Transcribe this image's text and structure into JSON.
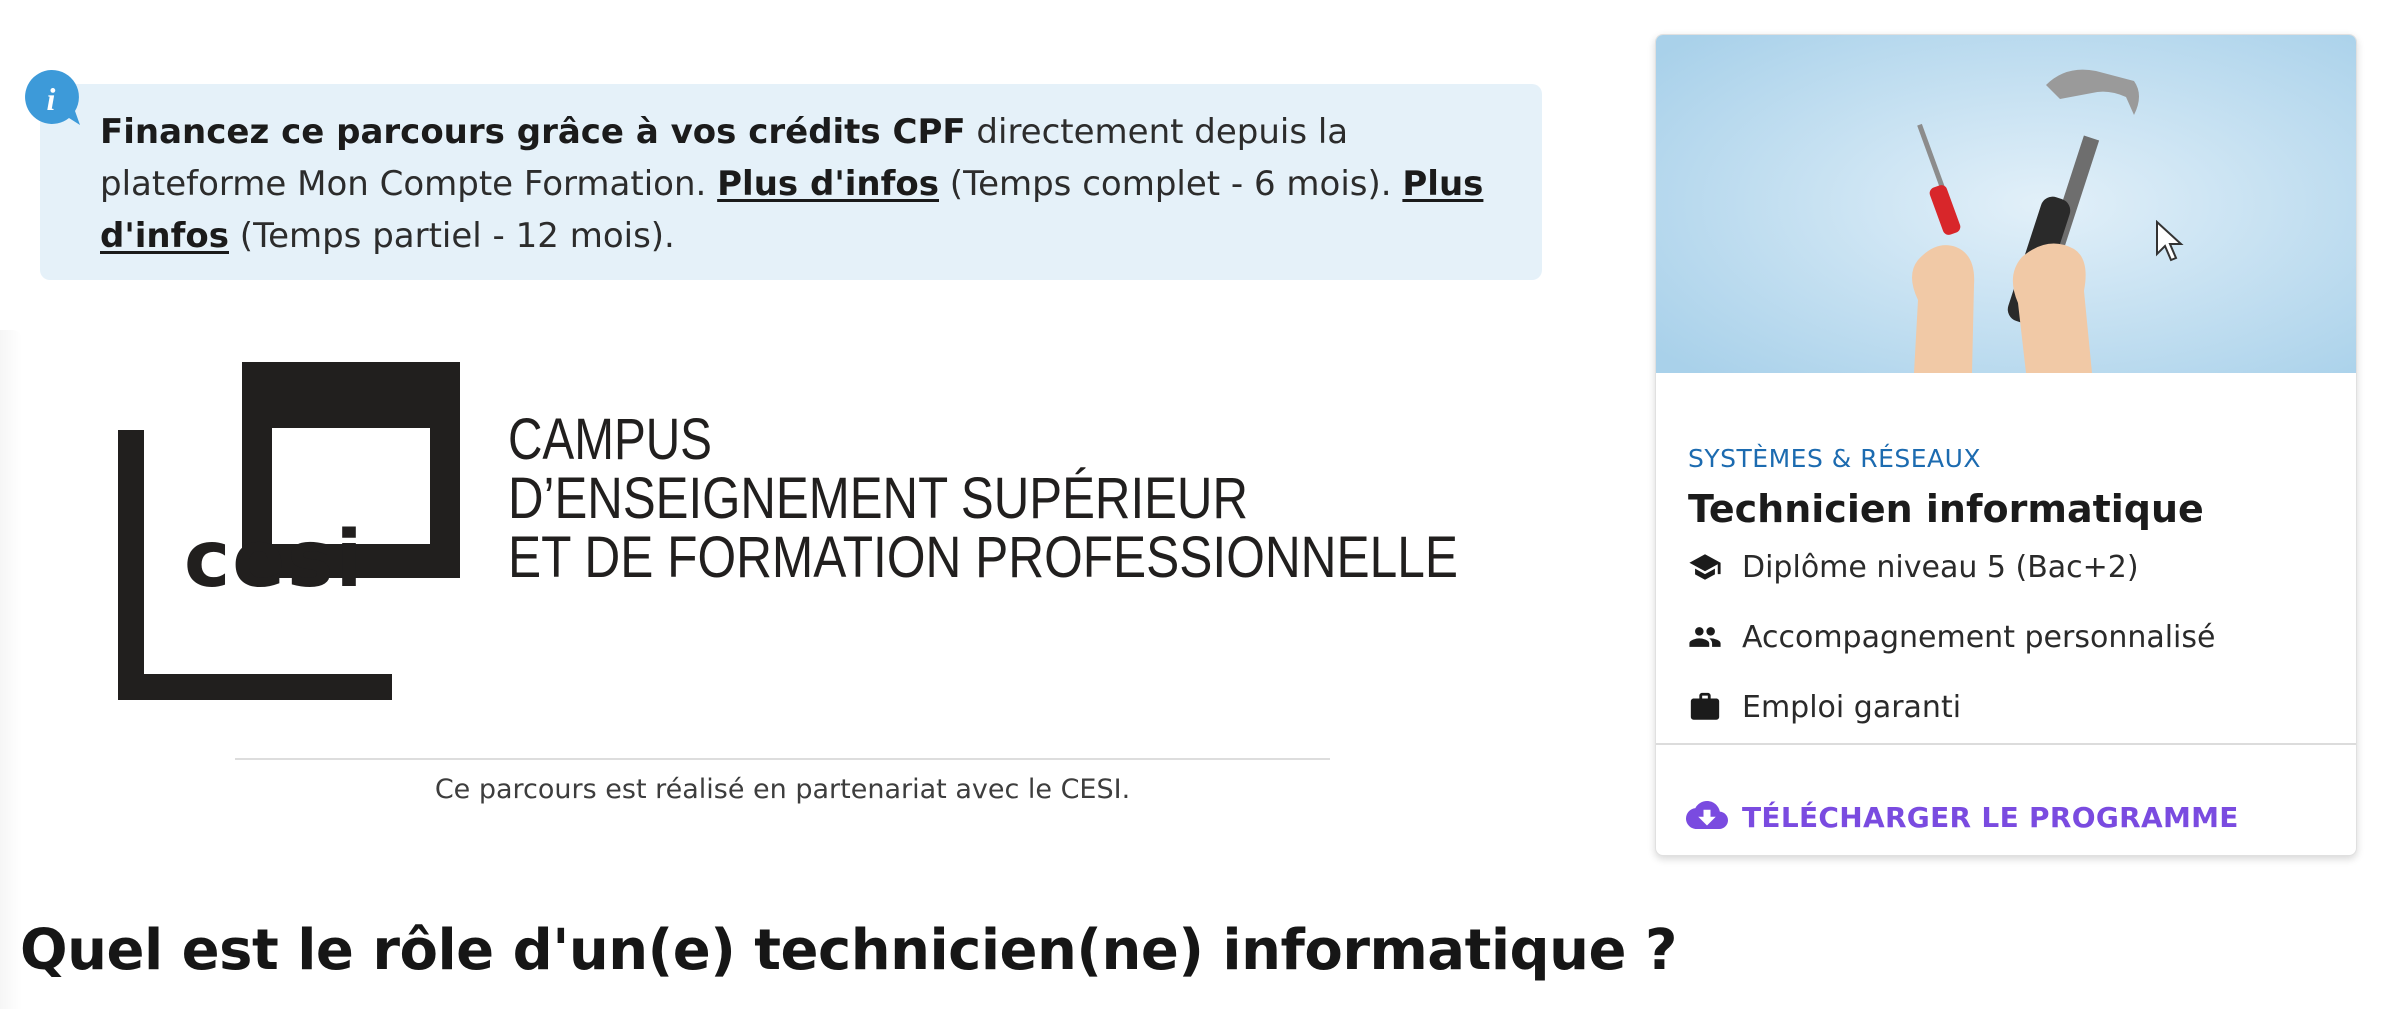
{
  "info_banner": {
    "bold_text": "Financez ce parcours grâce à vos crédits CPF",
    "text_1": " directement depuis la plateforme Mon Compte Formation. ",
    "link_1": "Plus d'infos",
    "text_2": " (Temps complet - 6 mois). ",
    "link_2": "Plus d'infos",
    "text_3": " (Temps partiel - 12 mois).",
    "icon": "info-icon",
    "icon_letter": "i"
  },
  "partner": {
    "logo_word": "cesi",
    "logo_line_1": "CAMPUS",
    "logo_line_2": "D’ENSEIGNEMENT SUPÉRIEUR",
    "logo_line_3": "ET DE FORMATION PROFESSIONNELLE",
    "caption": "Ce parcours est réalisé en partenariat avec le CESI."
  },
  "main": {
    "heading": "Quel est le rôle d'un(e) technicien(ne) informatique ?"
  },
  "card": {
    "category": "SYSTÈMES & RÉSEAUX",
    "title": "Technicien informatique",
    "features": [
      {
        "icon": "graduation-cap-icon",
        "label": "Diplôme niveau 5 (Bac+2)"
      },
      {
        "icon": "people-icon",
        "label": "Accompagnement personnalisé"
      },
      {
        "icon": "briefcase-icon",
        "label": "Emploi garanti"
      }
    ],
    "download_label": "TÉLÉCHARGER LE PROGRAMME",
    "download_icon": "cloud-download-icon"
  },
  "colors": {
    "info_bg": "#e5f1f9",
    "info_badge": "#3d9ad9",
    "category": "#1c6bb0",
    "download": "#7a4be0",
    "card_image_bg": "#a9d1ea"
  }
}
